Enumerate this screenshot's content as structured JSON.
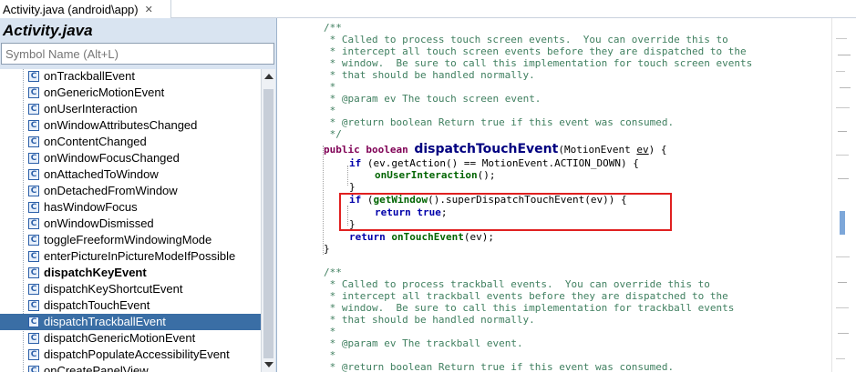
{
  "tab": {
    "label": "Activity.java (android\\app)",
    "close": "✕"
  },
  "outline": {
    "title": "Activity.java",
    "search_placeholder": "Symbol Name (Alt+L)",
    "icon_glyph": "C",
    "items": [
      {
        "label": "onTrackballEvent"
      },
      {
        "label": "onGenericMotionEvent"
      },
      {
        "label": "onUserInteraction"
      },
      {
        "label": "onWindowAttributesChanged"
      },
      {
        "label": "onContentChanged"
      },
      {
        "label": "onWindowFocusChanged"
      },
      {
        "label": "onAttachedToWindow"
      },
      {
        "label": "onDetachedFromWindow"
      },
      {
        "label": "hasWindowFocus"
      },
      {
        "label": "onWindowDismissed"
      },
      {
        "label": "toggleFreeformWindowingMode"
      },
      {
        "label": "enterPictureInPictureModeIfPossible"
      },
      {
        "label": "dispatchKeyEvent",
        "bold": true
      },
      {
        "label": "dispatchKeyShortcutEvent"
      },
      {
        "label": "dispatchTouchEvent"
      },
      {
        "label": "dispatchTrackballEvent",
        "selected": true
      },
      {
        "label": "dispatchGenericMotionEvent"
      },
      {
        "label": "dispatchPopulateAccessibilityEvent"
      },
      {
        "label": "onCreatePanelView"
      }
    ]
  },
  "code": {
    "l1": "/**",
    "l2": " * Called to process touch screen events.  You can override this to",
    "l3": " * intercept all touch screen events before they are dispatched to the",
    "l4": " * window.  Be sure to call this implementation for touch screen events",
    "l5": " * that should be handled normally.",
    "l6": " *",
    "l7a": " * ",
    "l7tag": "@param",
    "l7b": " ev The touch screen event.",
    "l8": " *",
    "l9a": " * ",
    "l9tag": "@return",
    "l9b": " boolean Return true if this event was consumed.",
    "l10": " */",
    "kw_public": "public",
    "kw_boolean": "boolean",
    "method_name": "dispatchTouchEvent",
    "param_open": "(MotionEvent ",
    "param_name": "ev",
    "param_close": ") {",
    "kw_if": "if",
    "if1_body": " (ev.getAction() == MotionEvent.ACTION_DOWN) {",
    "call_user": "onUserInteraction",
    "call_user_tail": "();",
    "close_brace": "}",
    "if2_open": " (",
    "call_getwindow": "getWindow",
    "if2_body": "().superDispatchTouchEvent(ev)) {",
    "kw_return": "return",
    "kw_true": "true",
    "semi": ";",
    "call_ontouch": "onTouchEvent",
    "ontouch_tail": "(ev);",
    "t1": "/**",
    "t2": " * Called to process trackball events.  You can override this to",
    "t3": " * intercept all trackball events before they are dispatched to the",
    "t4": " * window.  Be sure to call this implementation for trackball events",
    "t5": " * that should be handled normally.",
    "t6": " *",
    "t7a": " * ",
    "t7tag": "@param",
    "t7b": " ev The trackball event.",
    "t8": " *",
    "t9a": " * ",
    "t9tag": "@return",
    "t9b": " boolean Return true if this event was consumed."
  },
  "colors": {
    "comment": "#3f7f5f",
    "keyword": "#7f0055",
    "selection": "#3a6ea5",
    "highlight_box": "#e02020",
    "panel_bg": "#d9e4f1"
  }
}
